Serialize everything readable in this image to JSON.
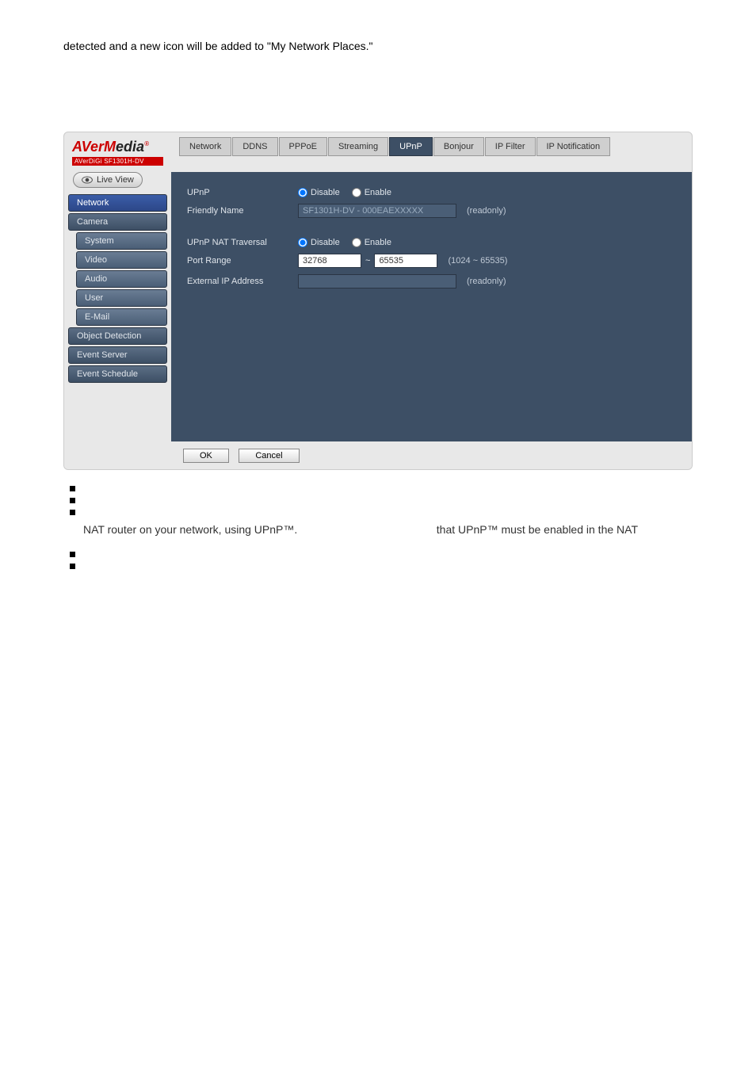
{
  "page_intro": "detected and a new icon will be added to \"My Network Places.\"",
  "logo": {
    "brand_html": "AVerMedia",
    "subline": "AVerDiGi SF1301H-DV"
  },
  "tabs": [
    "Network",
    "DDNS",
    "PPPoE",
    "Streaming",
    "UPnP",
    "Bonjour",
    "IP Filter",
    "IP Notification"
  ],
  "active_tab": "UPnP",
  "live_view_label": "Live View",
  "sidebar_items": [
    {
      "label": "Network",
      "sub": false,
      "active": true
    },
    {
      "label": "Camera",
      "sub": false,
      "active": false
    },
    {
      "label": "System",
      "sub": true,
      "active": false
    },
    {
      "label": "Video",
      "sub": true,
      "active": false
    },
    {
      "label": "Audio",
      "sub": true,
      "active": false
    },
    {
      "label": "User",
      "sub": true,
      "active": false
    },
    {
      "label": "E-Mail",
      "sub": true,
      "active": false
    },
    {
      "label": "Object Detection",
      "sub": false,
      "active": false
    },
    {
      "label": "Event Server",
      "sub": false,
      "active": false
    },
    {
      "label": "Event Schedule",
      "sub": false,
      "active": false
    }
  ],
  "form": {
    "upnp_label": "UPnP",
    "friendly_name_label": "Friendly Name",
    "friendly_name_value": "SF1301H-DV - 000EAEXXXXX",
    "nat_label": "UPnP NAT Traversal",
    "port_range_label": "Port Range",
    "port_low": "32768",
    "port_high": "65535",
    "port_note": "(1024 ~ 65535)",
    "external_ip_label": "External IP Address",
    "external_ip_value": "",
    "readonly_note": "(readonly)",
    "disable_label": "Disable",
    "enable_label": "Enable"
  },
  "actions": {
    "ok": "OK",
    "cancel": "Cancel"
  },
  "footer_left": "NAT router on your network, using UPnP™.",
  "footer_right": "that UPnP™ must be enabled in the NAT"
}
